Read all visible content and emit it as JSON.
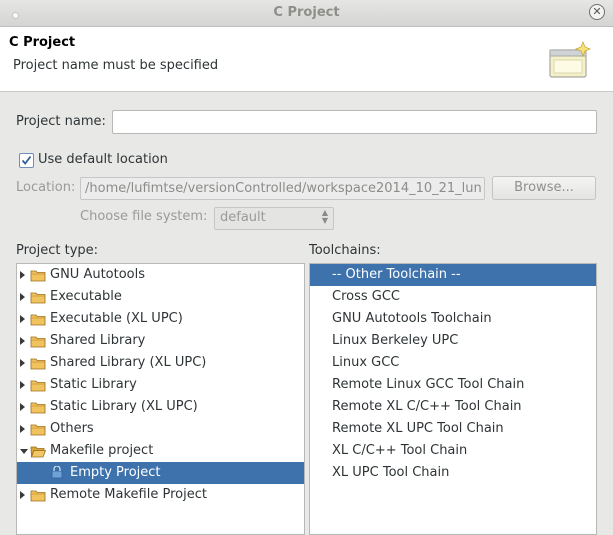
{
  "window": {
    "title": "C Project"
  },
  "header": {
    "title": "C Project",
    "message": "Project name must be specified"
  },
  "form": {
    "project_name_label": "Project name:",
    "project_name_value": "",
    "use_default_label": "Use default location",
    "use_default_checked": true,
    "location_label": "Location:",
    "location_value": "/home/lufimtse/versionControlled/workspace2014_10_21_lun",
    "browse_label": "Browse...",
    "file_system_label": "Choose file system:",
    "file_system_value": "default"
  },
  "project_type": {
    "label": "Project type:",
    "items": [
      {
        "label": "GNU Autotools",
        "icon": "folder-icon",
        "expander": "collapsed"
      },
      {
        "label": "Executable",
        "icon": "folder-icon",
        "expander": "collapsed"
      },
      {
        "label": "Executable (XL UPC)",
        "icon": "folder-icon",
        "expander": "collapsed"
      },
      {
        "label": "Shared Library",
        "icon": "folder-icon",
        "expander": "collapsed"
      },
      {
        "label": "Shared Library (XL UPC)",
        "icon": "folder-icon",
        "expander": "collapsed"
      },
      {
        "label": "Static Library",
        "icon": "folder-icon",
        "expander": "collapsed"
      },
      {
        "label": "Static Library (XL UPC)",
        "icon": "folder-icon",
        "expander": "collapsed"
      },
      {
        "label": "Others",
        "icon": "folder-icon",
        "expander": "collapsed"
      },
      {
        "label": "Makefile project",
        "icon": "folder-open-icon",
        "expander": "expanded"
      },
      {
        "label": "Empty Project",
        "icon": "project-icon",
        "expander": "none",
        "selected": true
      },
      {
        "label": "Remote Makefile Project",
        "icon": "folder-icon",
        "expander": "collapsed"
      }
    ]
  },
  "toolchains": {
    "label": "Toolchains:",
    "items": [
      {
        "label": "-- Other Toolchain --",
        "selected": true
      },
      {
        "label": "Cross GCC"
      },
      {
        "label": "GNU Autotools Toolchain"
      },
      {
        "label": "Linux Berkeley UPC"
      },
      {
        "label": "Linux GCC"
      },
      {
        "label": "Remote Linux GCC Tool Chain"
      },
      {
        "label": "Remote XL C/C++ Tool Chain"
      },
      {
        "label": "Remote XL UPC Tool Chain"
      },
      {
        "label": "XL C/C++ Tool Chain"
      },
      {
        "label": "XL UPC Tool Chain"
      }
    ]
  },
  "colors": {
    "selection": "#3d72ad",
    "folder": "#e8b84a"
  }
}
